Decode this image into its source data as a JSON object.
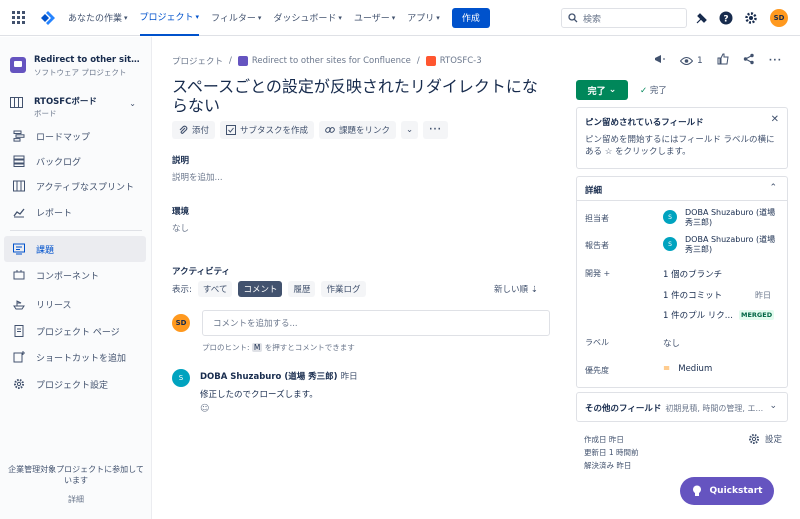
{
  "nav": {
    "items": [
      "あなたの作業",
      "プロジェクト",
      "フィルター",
      "ダッシュボード",
      "ユーザー",
      "アプリ"
    ],
    "create": "作成",
    "search_placeholder": "検索",
    "avatar": "SD",
    "accent": "#0052cc"
  },
  "sidebar": {
    "project_name": "Redirect to other sites f...",
    "project_type": "ソフトウェア プロジェクト",
    "board_name": "RTOSFCボード",
    "board_type": "ボード",
    "items": [
      "ロードマップ",
      "バックログ",
      "アクティブなスプリント",
      "レポート",
      "課題",
      "コンポーネント",
      "リリース",
      "プロジェクト ページ",
      "ショートカットを追加",
      "プロジェクト設定"
    ],
    "footer": "企業管理対象プロジェクトに参加しています",
    "footer_link": "詳細"
  },
  "breadcrumb": {
    "root": "プロジェクト",
    "project": "Redirect to other sites for Confluence",
    "issue_key": "RTOSFC-3"
  },
  "issue": {
    "watchers": "1",
    "title": "スペースごとの設定が反映されたリダイレクトにならない",
    "toolbar": [
      "添付",
      "サブタスクを作成",
      "課題をリンク"
    ],
    "description_label": "説明",
    "description_placeholder": "説明を追加...",
    "env_label": "環境",
    "env_value": "なし",
    "activity_label": "アクティビティ",
    "show_label": "表示:",
    "filters": [
      "すべて",
      "コメント",
      "履歴",
      "作業ログ"
    ],
    "sort": "新しい順",
    "comment_placeholder": "コメントを追加する...",
    "hint_prefix": "プロのヒント:",
    "hint_key": "M",
    "hint_suffix": "を押すとコメントできます",
    "my_avatar": "SD"
  },
  "comment": {
    "avatar": "S",
    "author": "DOBA Shuzaburo (道場 秀三郎)",
    "time": "昨日",
    "text": "修正したのでクローズします。"
  },
  "right": {
    "status": "完了",
    "resolution": "完了",
    "pin_title": "ピン留めされているフィールド",
    "pin_desc": "ピン留めを開始するにはフィールド ラベルの横にある ☆ をクリックします。",
    "details_title": "詳細",
    "assignee_label": "担当者",
    "assignee": "DOBA Shuzaburo (道場 秀三郎)",
    "reporter_label": "報告者",
    "reporter": "DOBA Shuzaburo (道場 秀三郎)",
    "dev_label": "開発",
    "dev_branch": "1 個のブランチ",
    "dev_commit": "1 件のコミット",
    "dev_commit_time": "昨日",
    "dev_pr": "1 件のプル リク...",
    "dev_pr_badge": "MERGED",
    "label_label": "ラベル",
    "label_value": "なし",
    "priority_label": "優先度",
    "priority_value": "Medium",
    "other_title": "その他のフィールド",
    "other_sub": "初期見積, 時間の管理, エ...",
    "created": "作成日 昨日",
    "updated": "更新日 1 時間前",
    "resolved": "解決済み 昨日",
    "settings": "設定",
    "quickstart": "Quickstart"
  }
}
